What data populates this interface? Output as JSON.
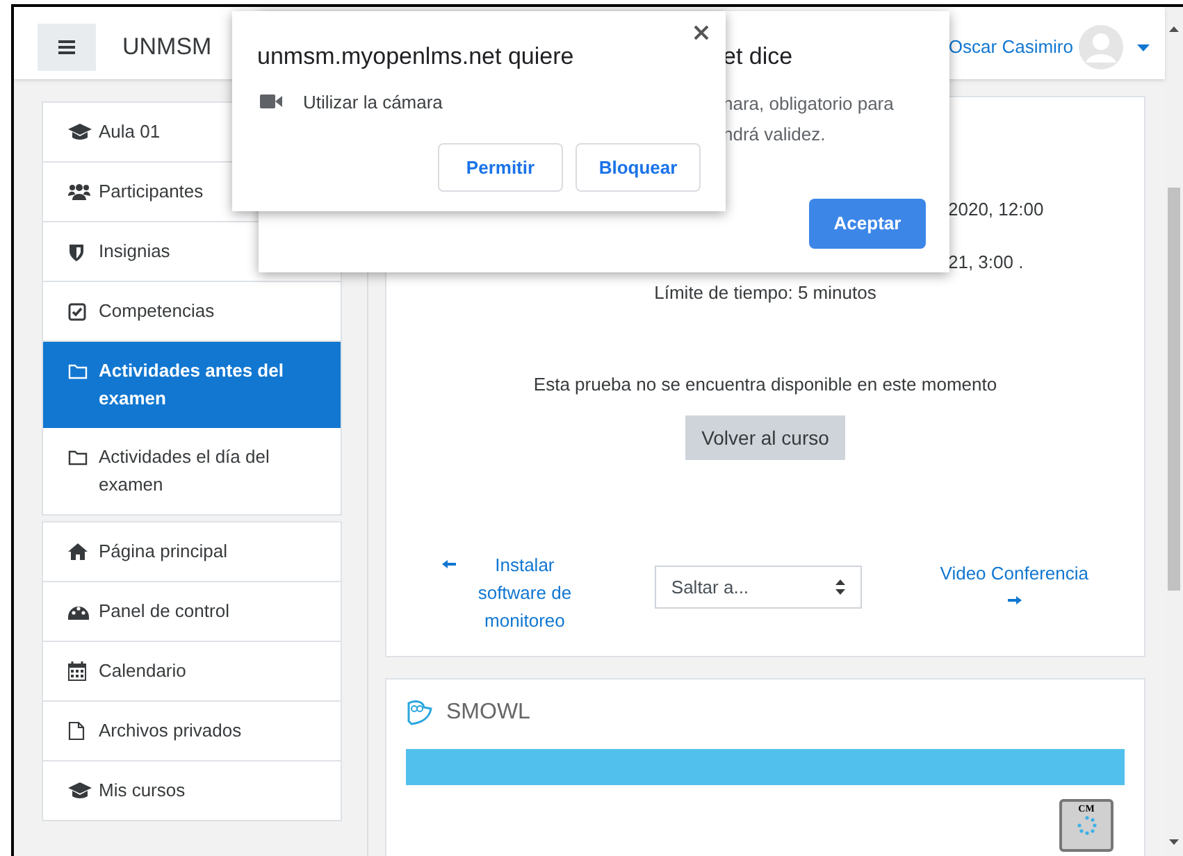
{
  "navbar": {
    "site_name": "UNMSM",
    "user_name": "Oscar Casimiro"
  },
  "sidebar": {
    "course_items": [
      {
        "label": "Aula 01",
        "selected": false
      },
      {
        "label": "Participantes",
        "selected": false
      },
      {
        "label": "Insignias",
        "selected": false
      },
      {
        "label": "Competencias",
        "selected": false
      },
      {
        "label": "Actividades antes del examen",
        "selected": true
      },
      {
        "label": "Actividades el día del examen",
        "selected": false
      }
    ],
    "site_items": [
      {
        "label": "Página principal",
        "selected": false
      },
      {
        "label": "Panel de control",
        "selected": false
      },
      {
        "label": "Calendario",
        "selected": false
      },
      {
        "label": "Archivos privados",
        "selected": false
      },
      {
        "label": "Mis cursos",
        "selected": false
      }
    ]
  },
  "quiz": {
    "open_date": "2020, 12:00",
    "close_date": "21, 3:00 .",
    "time_limit": "Límite de tiempo: 5 minutos",
    "unavailable_message": "Esta prueba no se encuentra disponible en este momento",
    "back_button": "Volver al curso",
    "prev_link": "Instalar software de monitoreo",
    "jump_select": "Saltar a...",
    "next_link": "Video Conferencia"
  },
  "smowl": {
    "title": "SMOWL",
    "badge": "CM"
  },
  "alert_dialog": {
    "title": "et dice",
    "message_lines": [
      "nara, obligatorio para",
      "ndrá validez."
    ],
    "button": "Aceptar"
  },
  "permission_popup": {
    "title": "unmsm.myopenlms.net quiere",
    "permission": "Utilizar la cámara",
    "buttons": [
      "Permitir",
      "Bloquear"
    ]
  }
}
